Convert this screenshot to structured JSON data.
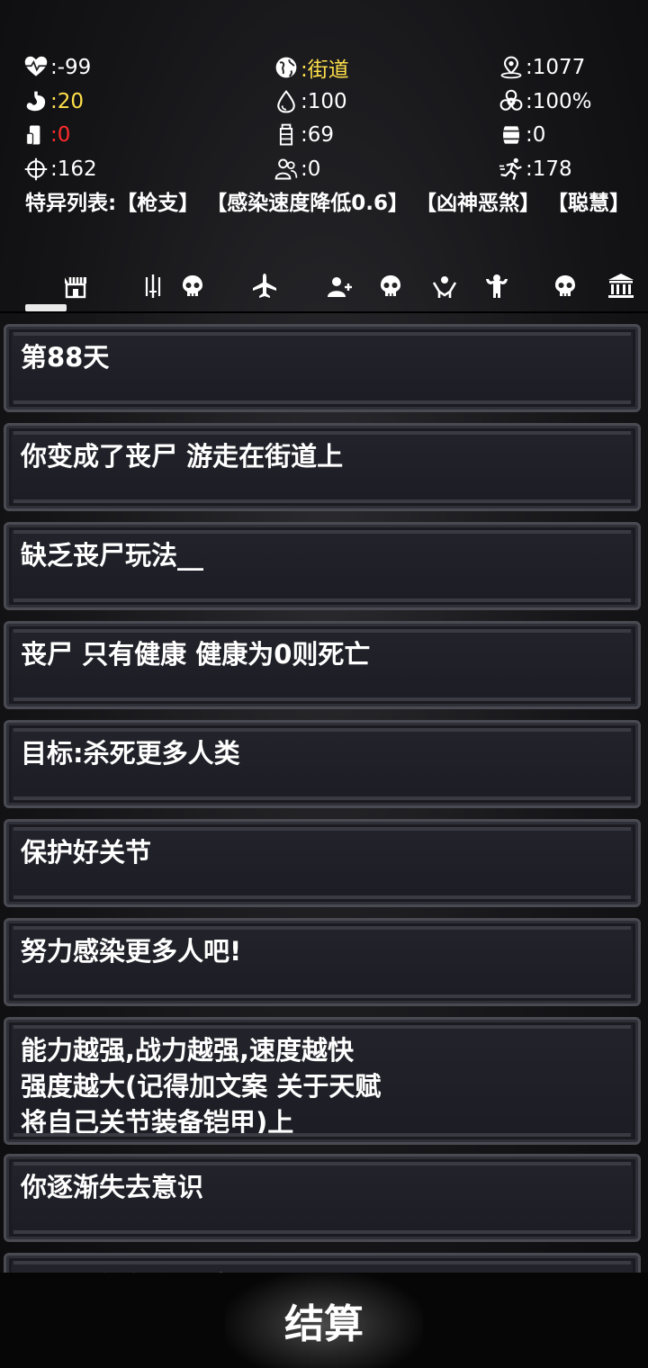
{
  "stats": [
    [
      {
        "icon": "heartbeat-icon",
        "value": ":-99",
        "color": "white"
      },
      {
        "icon": "globe-icon",
        "value": ":街道",
        "color": "yellow"
      },
      {
        "icon": "location-pin-icon",
        "value": ":1077",
        "color": "white"
      }
    ],
    [
      {
        "icon": "stomach-icon",
        "value": ":20",
        "color": "yellow"
      },
      {
        "icon": "water-drop-icon",
        "value": ":100",
        "color": "white"
      },
      {
        "icon": "biohazard-icon",
        "value": ":100%",
        "color": "white"
      }
    ],
    [
      {
        "icon": "phone-icon",
        "value": ":0",
        "color": "red"
      },
      {
        "icon": "bottle-icon",
        "value": ":69",
        "color": "white"
      },
      {
        "icon": "barrel-icon",
        "value": ":0",
        "color": "white"
      }
    ],
    [
      {
        "icon": "crosshair-icon",
        "value": ":162",
        "color": "white"
      },
      {
        "icon": "people-icon",
        "value": ":0",
        "color": "white"
      },
      {
        "icon": "running-icon",
        "value": ":178",
        "color": "white"
      }
    ]
  ],
  "traits": "特异列表:【枪支】 【感染速度降低0.6】 【凶神恶煞】 【聪慧】",
  "tabs": [
    "shop-icon",
    "weapons-icon",
    "skull-icon",
    "airplane-icon",
    "add-person-icon",
    "skull-icon",
    "hands-icon",
    "muscle-icon",
    "skull-icon",
    "bank-icon"
  ],
  "messages": [
    "第88天",
    "你变成了丧尸 游走在街道上",
    "缺乏丧尸玩法__",
    "丧尸 只有健康 健康为0则死亡",
    "目标:杀死更多人类",
    "保护好关节",
    "努力感染更多人吧!",
    "能力越强,战力越强,速度越快\n强度越大(记得加文案 关于天赋\n将自己关节装备铠甲)上",
    "你逐渐失去意识",
    "你想想给刻在了地上"
  ],
  "settle_label": "结算",
  "colors": {
    "yellow": "#ffe04a",
    "red": "#ff2b2b",
    "white": "#ffffff"
  }
}
